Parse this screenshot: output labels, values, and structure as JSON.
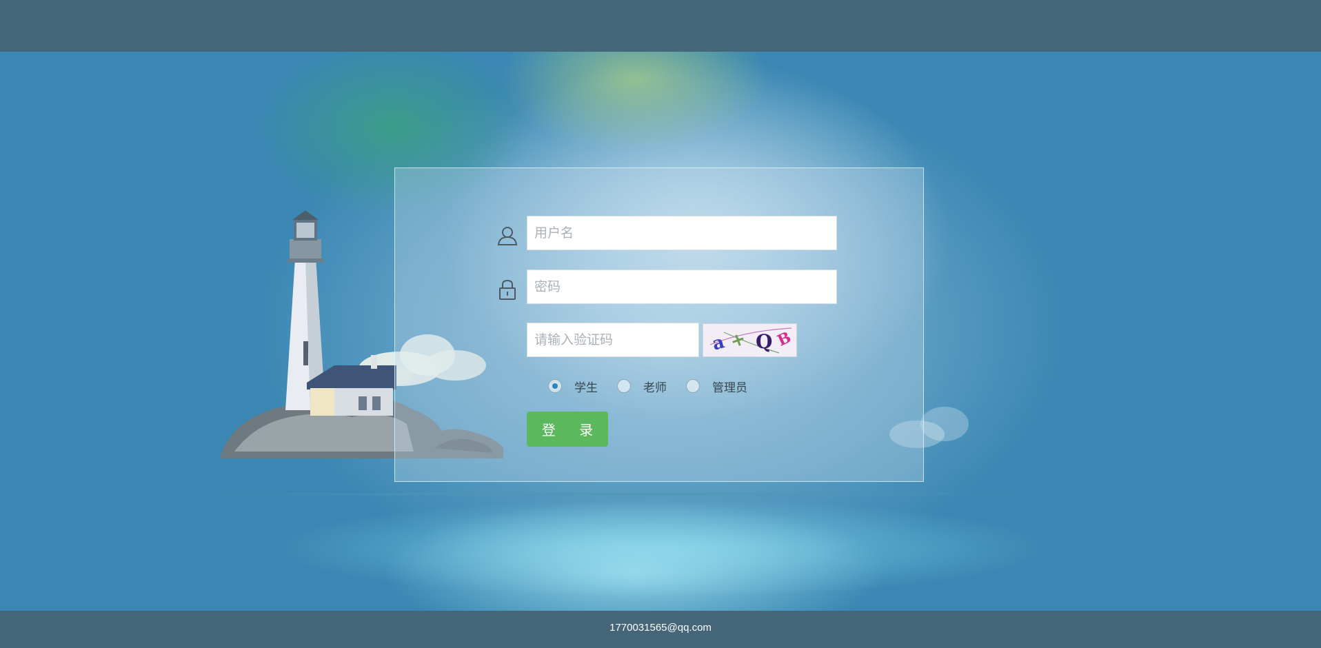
{
  "login": {
    "username_placeholder": "用户名",
    "password_placeholder": "密码",
    "captcha_placeholder": "请输入验证码",
    "captcha_text": "a+QB",
    "roles": [
      {
        "label": "学生",
        "checked": true
      },
      {
        "label": "老师",
        "checked": false
      },
      {
        "label": "管理员",
        "checked": false
      }
    ],
    "submit_label": "登 录"
  },
  "footer": {
    "email": "1770031565@qq.com"
  },
  "colors": {
    "header_bar": "#446678",
    "background": "#3a87b3",
    "button": "#5cb85c",
    "radio_checked": "#2e86c1"
  },
  "icons": {
    "username": "user-icon",
    "password": "lock-icon"
  }
}
